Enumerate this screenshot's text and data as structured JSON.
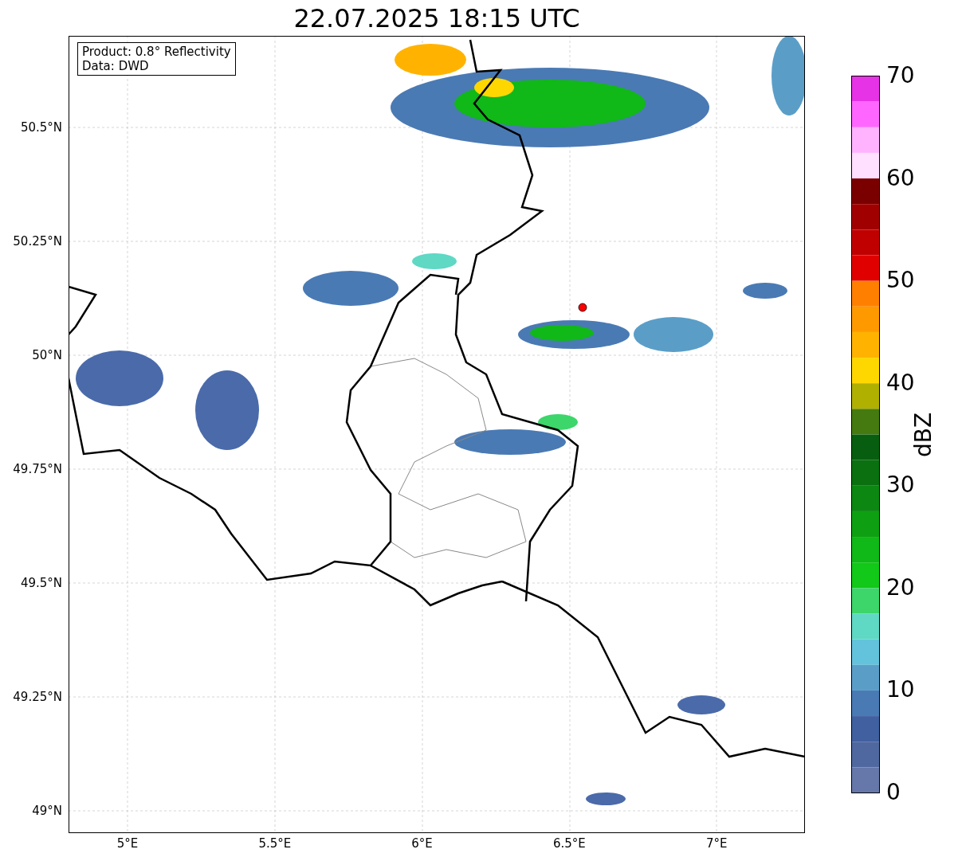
{
  "title": "22.07.2025 18:15 UTC",
  "info_box": {
    "lines": [
      "Product: 0.8° Reflectivity",
      "Data: DWD"
    ]
  },
  "axes": {
    "x_ticks": [
      "5°E",
      "5.5°E",
      "6°E",
      "6.5°E",
      "7°E"
    ],
    "y_ticks": [
      "50.5°N",
      "50.25°N",
      "50°N",
      "49.75°N",
      "49.5°N",
      "49.25°N",
      "49°N"
    ]
  },
  "colorbar": {
    "label": "dBZ",
    "ticks": [
      "70",
      "60",
      "50",
      "40",
      "30",
      "20",
      "10",
      "0"
    ],
    "bins": [
      {
        "color": "#e633e6"
      },
      {
        "color": "#ff66ff"
      },
      {
        "color": "#ffb3ff"
      },
      {
        "color": "#ffe0ff"
      },
      {
        "color": "#7a0000"
      },
      {
        "color": "#a00000"
      },
      {
        "color": "#c00000"
      },
      {
        "color": "#e00000"
      },
      {
        "color": "#ff8000"
      },
      {
        "color": "#ff9900"
      },
      {
        "color": "#ffb300"
      },
      {
        "color": "#ffd700"
      },
      {
        "color": "#b0b000"
      },
      {
        "color": "#457a10"
      },
      {
        "color": "#085e10"
      },
      {
        "color": "#0a7010"
      },
      {
        "color": "#0c8812"
      },
      {
        "color": "#0ea012"
      },
      {
        "color": "#10b818"
      },
      {
        "color": "#12c818"
      },
      {
        "color": "#3cd66a"
      },
      {
        "color": "#5fd8c4"
      },
      {
        "color": "#63c3dc"
      },
      {
        "color": "#5a9ec8"
      },
      {
        "color": "#4a7ab4"
      },
      {
        "color": "#4060a0"
      },
      {
        "color": "#5068a0"
      },
      {
        "color": "#6677aa"
      }
    ]
  }
}
